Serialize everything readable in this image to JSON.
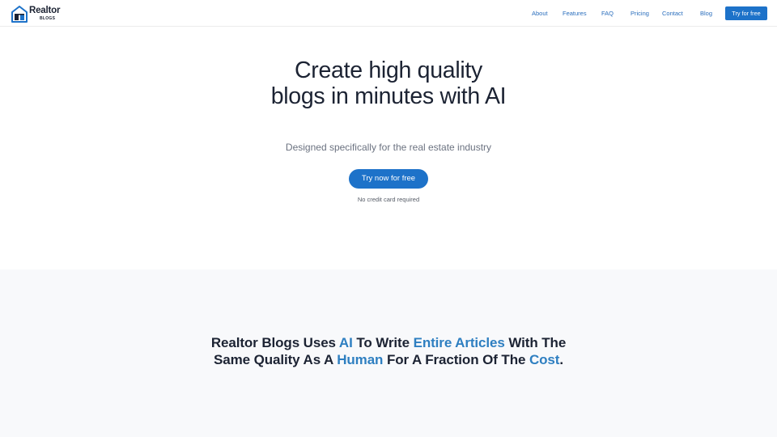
{
  "brand": {
    "name": "Realtor",
    "sub": "BLOGS",
    "color": "#1d72c9"
  },
  "nav": {
    "items": [
      {
        "label": "About"
      },
      {
        "label": "Features"
      },
      {
        "label": "FAQ"
      },
      {
        "label": "Pricing"
      },
      {
        "label": "Contact"
      },
      {
        "label": "Blog"
      }
    ],
    "cta_label": "Try for free"
  },
  "hero": {
    "title": "Create high quality blogs in minutes with AI",
    "subtitle": "Designed specifically for the real estate industry",
    "cta_label": "Try now for free",
    "note": "No credit card required"
  },
  "features": {
    "heading": {
      "p1": "Realtor Blogs Uses ",
      "h1": "AI",
      "p2": " To Write ",
      "h2": "Entire Articles",
      "p3": " With The Same Quality As A ",
      "h3": "Human",
      "p4": " For A Fraction Of The ",
      "h4": "Cost",
      "p5": "."
    },
    "highlight_color": "#2e7fc1"
  }
}
